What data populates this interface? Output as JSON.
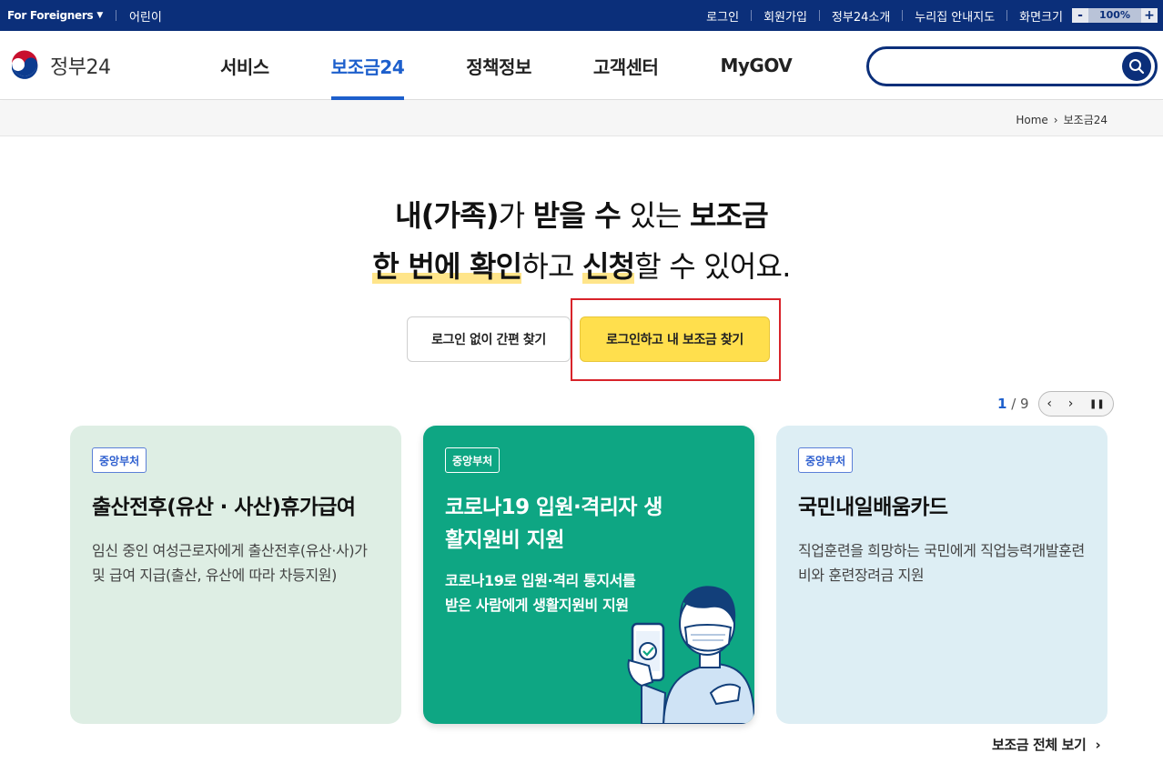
{
  "topbar": {
    "foreigners": "For Foreigners",
    "kids": "어린이",
    "links": [
      "로그인",
      "회원가입",
      "정부24소개",
      "누리집 안내지도",
      "화면크기"
    ],
    "zoom_minus": "-",
    "zoom_value": "100%",
    "zoom_plus": "+"
  },
  "header": {
    "logo_text": "정부24",
    "nav": [
      "서비스",
      "보조금24",
      "정책정보",
      "고객센터",
      "MyGOV"
    ],
    "active_nav": "보조금24",
    "search_placeholder": ""
  },
  "breadcrumb": [
    "Home",
    "보조금24"
  ],
  "hero": {
    "line1_a": "내(가족)",
    "line1_b": "가 ",
    "line1_c": "받을 수",
    "line1_d": " 있는 ",
    "line1_e": "보조금",
    "line2_a": "한 번에 확인",
    "line2_b": "하고 ",
    "line2_c": "신청",
    "line2_d": "할 수 있어요."
  },
  "buttons": {
    "no_login": "로그인 없이 간편 찾기",
    "login_find": "로그인하고 내 보조금 찾기"
  },
  "pager": {
    "current": "1",
    "total": "/ 9",
    "prev": "‹",
    "next": "›",
    "pause": "❚❚"
  },
  "cards": [
    {
      "tag": "중앙부처",
      "title": "출산전후(유산 · 사산)휴가급여",
      "desc": "임신 중인 여성근로자에게 출산전후(유산·사)가 및 급여 지급(출산, 유산에 따라 차등지원)"
    },
    {
      "tag": "중앙부처",
      "title": "코로나19 입원·격리자 생활지원비 지원",
      "desc": "코로나19로 입원·격리 통지서를 받은 사람에게 생활지원비 지원"
    },
    {
      "tag": "중앙부처",
      "title": "국민내일배움카드",
      "desc": "직업훈련을 희망하는 국민에게 직업능력개발훈련비와 훈련장려금 지원"
    }
  ],
  "more_link": "보조금 전체 보기",
  "colors": {
    "navy": "#0b2f7a",
    "accent_blue": "#1d5fcc",
    "yellow": "#ffdf4d",
    "green_card": "#0ea683",
    "highlight_box": "#d8232a"
  }
}
